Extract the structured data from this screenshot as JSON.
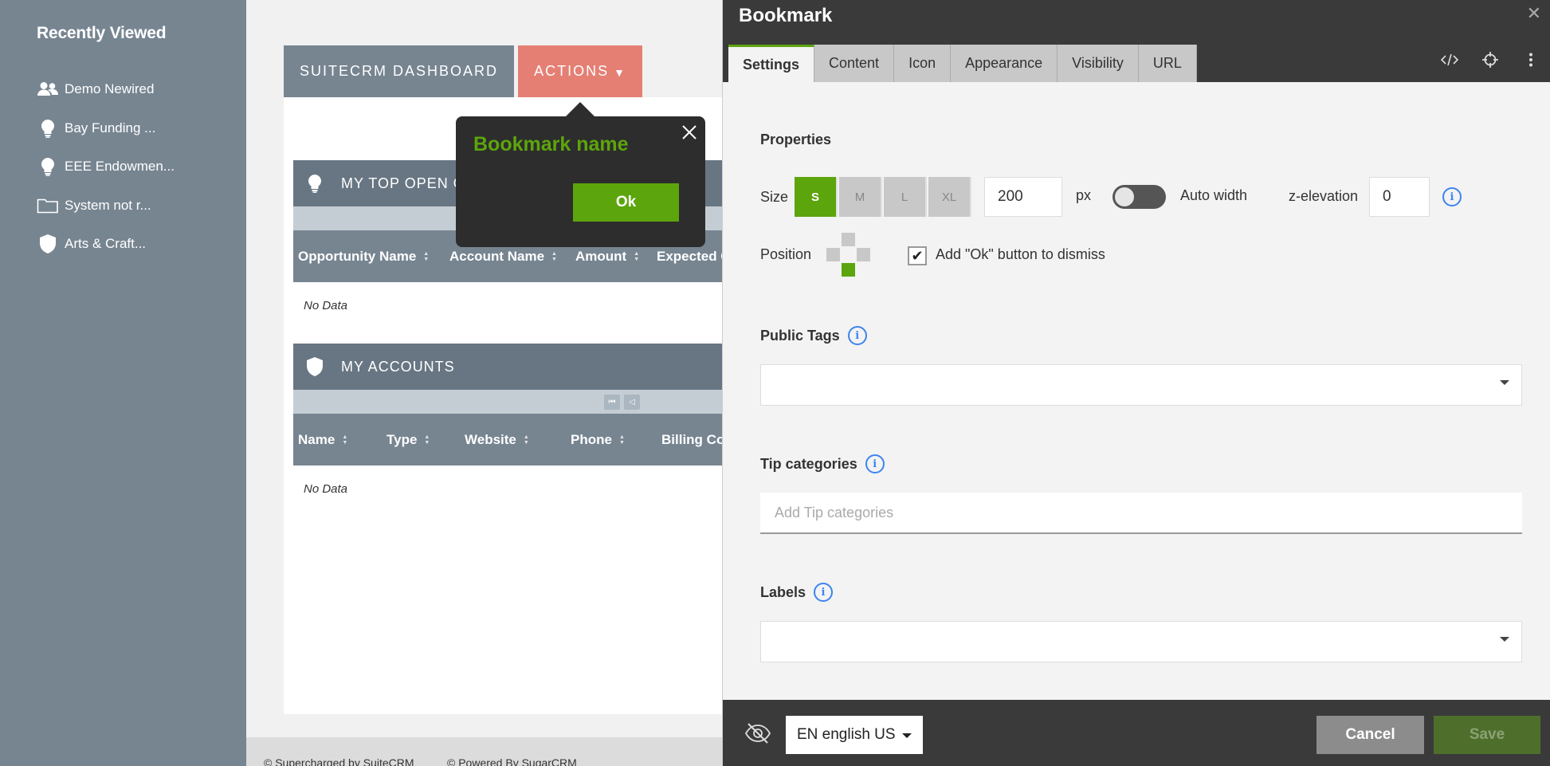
{
  "sidebar": {
    "title": "Recently Viewed",
    "items": [
      {
        "label": "Demo Newired",
        "icon": "users-icon"
      },
      {
        "label": "Bay Funding ...",
        "icon": "lightbulb-icon"
      },
      {
        "label": "EEE Endowmen...",
        "icon": "lightbulb-icon"
      },
      {
        "label": "System not r...",
        "icon": "folder-icon"
      },
      {
        "label": "Arts & Craft...",
        "icon": "shield-icon"
      }
    ],
    "collapse_glyph": "◁"
  },
  "main": {
    "tab_dashboard": "SUITECRM DASHBOARD",
    "tab_actions": "ACTIONS",
    "dashlets": [
      {
        "title": "MY TOP OPEN O",
        "columns": [
          "Opportunity Name",
          "Account Name",
          "Amount",
          "Expected C"
        ],
        "empty_text": "No Data"
      },
      {
        "title": "MY ACCOUNTS",
        "columns": [
          "Name",
          "Type",
          "Website",
          "Phone",
          "Billing Co"
        ],
        "empty_text": "No Data"
      }
    ],
    "footer": {
      "supercharged": "© Supercharged by SuiteCRM",
      "powered": "© Powered By SugarCRM"
    }
  },
  "tooltip": {
    "title": "Bookmark name",
    "ok_label": "Ok",
    "title_color": "#5ca50c"
  },
  "editor": {
    "title": "Bookmark",
    "tabs": [
      "Settings",
      "Content",
      "Icon",
      "Appearance",
      "Visibility",
      "URL"
    ],
    "active_tab": "Settings",
    "properties_title": "Properties",
    "size_label": "Size",
    "sizes": [
      "S",
      "M",
      "L",
      "XL"
    ],
    "selected_size": "S",
    "width_value": "200",
    "px_label": "px",
    "auto_width_label": "Auto width",
    "auto_width_on": false,
    "z_elevation_label": "z-elevation",
    "z_elevation_value": "0",
    "position_label": "Position",
    "selected_position": "bottom",
    "ok_dismiss_label": "Add \"Ok\" button to dismiss",
    "ok_dismiss_checked": true,
    "public_tags_label": "Public Tags",
    "tip_categories_label": "Tip categories",
    "tip_categories_placeholder": "Add Tip categories",
    "labels_label": "Labels",
    "language": "EN english US",
    "cancel_label": "Cancel",
    "save_label": "Save",
    "accent_color": "#5ca50c"
  }
}
